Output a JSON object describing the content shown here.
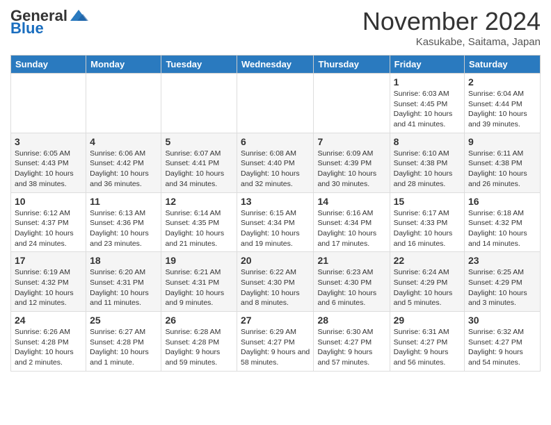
{
  "logo": {
    "general": "General",
    "blue": "Blue",
    "tagline": ""
  },
  "title": "November 2024",
  "location": "Kasukabe, Saitama, Japan",
  "days_of_week": [
    "Sunday",
    "Monday",
    "Tuesday",
    "Wednesday",
    "Thursday",
    "Friday",
    "Saturday"
  ],
  "weeks": [
    [
      {
        "day": "",
        "info": ""
      },
      {
        "day": "",
        "info": ""
      },
      {
        "day": "",
        "info": ""
      },
      {
        "day": "",
        "info": ""
      },
      {
        "day": "",
        "info": ""
      },
      {
        "day": "1",
        "info": "Sunrise: 6:03 AM\nSunset: 4:45 PM\nDaylight: 10 hours and 41 minutes."
      },
      {
        "day": "2",
        "info": "Sunrise: 6:04 AM\nSunset: 4:44 PM\nDaylight: 10 hours and 39 minutes."
      }
    ],
    [
      {
        "day": "3",
        "info": "Sunrise: 6:05 AM\nSunset: 4:43 PM\nDaylight: 10 hours and 38 minutes."
      },
      {
        "day": "4",
        "info": "Sunrise: 6:06 AM\nSunset: 4:42 PM\nDaylight: 10 hours and 36 minutes."
      },
      {
        "day": "5",
        "info": "Sunrise: 6:07 AM\nSunset: 4:41 PM\nDaylight: 10 hours and 34 minutes."
      },
      {
        "day": "6",
        "info": "Sunrise: 6:08 AM\nSunset: 4:40 PM\nDaylight: 10 hours and 32 minutes."
      },
      {
        "day": "7",
        "info": "Sunrise: 6:09 AM\nSunset: 4:39 PM\nDaylight: 10 hours and 30 minutes."
      },
      {
        "day": "8",
        "info": "Sunrise: 6:10 AM\nSunset: 4:38 PM\nDaylight: 10 hours and 28 minutes."
      },
      {
        "day": "9",
        "info": "Sunrise: 6:11 AM\nSunset: 4:38 PM\nDaylight: 10 hours and 26 minutes."
      }
    ],
    [
      {
        "day": "10",
        "info": "Sunrise: 6:12 AM\nSunset: 4:37 PM\nDaylight: 10 hours and 24 minutes."
      },
      {
        "day": "11",
        "info": "Sunrise: 6:13 AM\nSunset: 4:36 PM\nDaylight: 10 hours and 23 minutes."
      },
      {
        "day": "12",
        "info": "Sunrise: 6:14 AM\nSunset: 4:35 PM\nDaylight: 10 hours and 21 minutes."
      },
      {
        "day": "13",
        "info": "Sunrise: 6:15 AM\nSunset: 4:34 PM\nDaylight: 10 hours and 19 minutes."
      },
      {
        "day": "14",
        "info": "Sunrise: 6:16 AM\nSunset: 4:34 PM\nDaylight: 10 hours and 17 minutes."
      },
      {
        "day": "15",
        "info": "Sunrise: 6:17 AM\nSunset: 4:33 PM\nDaylight: 10 hours and 16 minutes."
      },
      {
        "day": "16",
        "info": "Sunrise: 6:18 AM\nSunset: 4:32 PM\nDaylight: 10 hours and 14 minutes."
      }
    ],
    [
      {
        "day": "17",
        "info": "Sunrise: 6:19 AM\nSunset: 4:32 PM\nDaylight: 10 hours and 12 minutes."
      },
      {
        "day": "18",
        "info": "Sunrise: 6:20 AM\nSunset: 4:31 PM\nDaylight: 10 hours and 11 minutes."
      },
      {
        "day": "19",
        "info": "Sunrise: 6:21 AM\nSunset: 4:31 PM\nDaylight: 10 hours and 9 minutes."
      },
      {
        "day": "20",
        "info": "Sunrise: 6:22 AM\nSunset: 4:30 PM\nDaylight: 10 hours and 8 minutes."
      },
      {
        "day": "21",
        "info": "Sunrise: 6:23 AM\nSunset: 4:30 PM\nDaylight: 10 hours and 6 minutes."
      },
      {
        "day": "22",
        "info": "Sunrise: 6:24 AM\nSunset: 4:29 PM\nDaylight: 10 hours and 5 minutes."
      },
      {
        "day": "23",
        "info": "Sunrise: 6:25 AM\nSunset: 4:29 PM\nDaylight: 10 hours and 3 minutes."
      }
    ],
    [
      {
        "day": "24",
        "info": "Sunrise: 6:26 AM\nSunset: 4:28 PM\nDaylight: 10 hours and 2 minutes."
      },
      {
        "day": "25",
        "info": "Sunrise: 6:27 AM\nSunset: 4:28 PM\nDaylight: 10 hours and 1 minute."
      },
      {
        "day": "26",
        "info": "Sunrise: 6:28 AM\nSunset: 4:28 PM\nDaylight: 9 hours and 59 minutes."
      },
      {
        "day": "27",
        "info": "Sunrise: 6:29 AM\nSunset: 4:27 PM\nDaylight: 9 hours and 58 minutes."
      },
      {
        "day": "28",
        "info": "Sunrise: 6:30 AM\nSunset: 4:27 PM\nDaylight: 9 hours and 57 minutes."
      },
      {
        "day": "29",
        "info": "Sunrise: 6:31 AM\nSunset: 4:27 PM\nDaylight: 9 hours and 56 minutes."
      },
      {
        "day": "30",
        "info": "Sunrise: 6:32 AM\nSunset: 4:27 PM\nDaylight: 9 hours and 54 minutes."
      }
    ]
  ]
}
